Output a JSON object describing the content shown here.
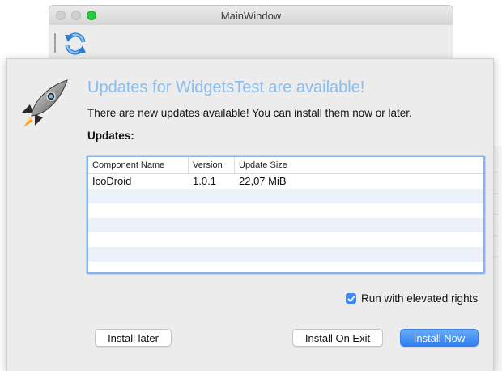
{
  "main_window": {
    "title": "MainWindow",
    "toolbar": {
      "icon": "refresh-icon"
    }
  },
  "dialog": {
    "heading": "Updates for WidgetsTest are available!",
    "message": "There are new updates available! You can install them now or later.",
    "updates_label": "Updates:",
    "icon": "rocket-icon",
    "table": {
      "columns": [
        "Component Name",
        "Version",
        "Update Size"
      ],
      "rows": [
        {
          "name": "IcoDroid",
          "version": "1.0.1",
          "size": "22,07 MiB"
        }
      ]
    },
    "elevated_checkbox": {
      "label": "Run with elevated rights",
      "checked": true
    },
    "buttons": {
      "install_later": "Install later",
      "install_on_exit": "Install On Exit",
      "install_now": "Install Now"
    },
    "colors": {
      "heading": "#88bdf1",
      "accent": "#3b87f5"
    }
  }
}
